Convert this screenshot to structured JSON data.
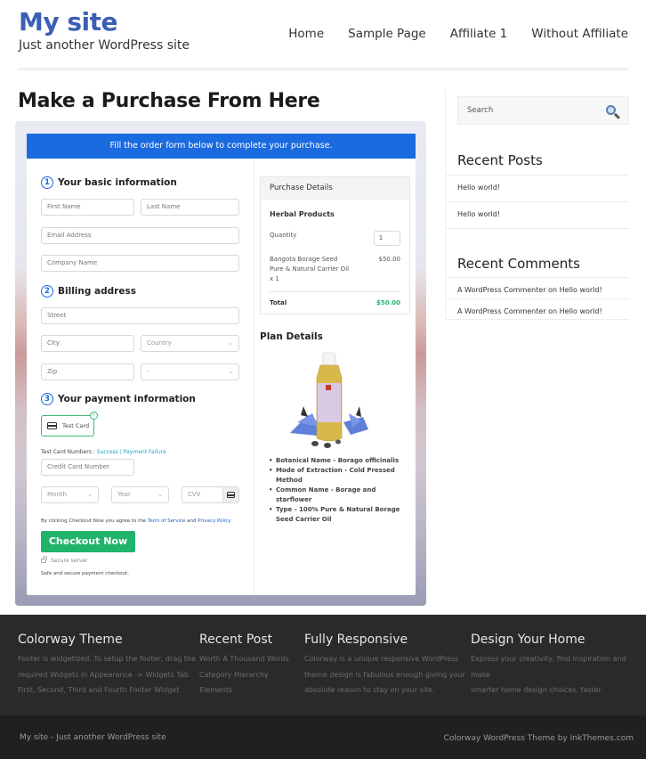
{
  "header": {
    "site_title": "My site",
    "tagline": "Just another WordPress site",
    "nav": [
      "Home",
      "Sample Page",
      "Affiliate 1",
      "Without Affiliate"
    ]
  },
  "page": {
    "title": "Make a Purchase From Here"
  },
  "checkout": {
    "banner": "Fill the order form below to complete your purchase.",
    "step1": {
      "num": "1",
      "label": "Your basic information"
    },
    "step2": {
      "num": "2",
      "label": "Billing address"
    },
    "step3": {
      "num": "3",
      "label": "Your payment information"
    },
    "placeholders": {
      "first_name": "First Name",
      "last_name": "Last Name",
      "email": "Email Address",
      "company": "Company Name",
      "street": "Street",
      "city": "City",
      "country": "Country",
      "zip": "Zip",
      "state": "-",
      "card_number": "Credit Card Number",
      "month": "Month",
      "year": "Year",
      "cvv": "CVV"
    },
    "payment_method": "Test Card",
    "test_numbers_label": "Test Card Numbers :",
    "test_success": "Success",
    "test_separator": "|",
    "test_failure": "Payment Failure",
    "terms_prefix": "By clicking Checkout Now you agree to the",
    "terms_link": "Term of Service",
    "terms_and": "and",
    "privacy_link": "Privacy Policy",
    "checkout_button": "Checkout Now",
    "secure_server": "Secure server",
    "safe_text": "Safe and secure payment checkout."
  },
  "purchase": {
    "heading": "Purchase Details",
    "product_group": "Herbal Products",
    "quantity_label": "Quantity",
    "quantity_value": "1",
    "item_line1": "Bangota Borage Seed",
    "item_line2": "Pure & Natural Carrier Oil",
    "item_line3": "x 1",
    "item_price": "$50.00",
    "total_label": "Total",
    "total_value": "$50.00",
    "total_color": "#22b36a"
  },
  "plan": {
    "title": "Plan Details",
    "features": [
      "Botanical Name - Borago officinalis",
      "Mode of Extraction - Cold Pressed Method",
      "Common Name - Borage and starflower",
      "Type - 100% Pure & Natural Borage Seed Carrier Oil"
    ]
  },
  "sidebar": {
    "search_placeholder": "Search",
    "recent_posts_title": "Recent Posts",
    "recent_posts": [
      "Hello world!",
      "Hello world!"
    ],
    "recent_comments_title": "Recent Comments",
    "recent_comments": [
      "A WordPress Commenter on Hello world!",
      "A WordPress Commenter on Hello world!"
    ]
  },
  "footer": {
    "columns": [
      {
        "title": "Colorway Theme",
        "lines": [
          "Footer is widgetized. To setup the footer, drag the",
          "required Widgets in Appearance -> Widgets Tab",
          "First, Second, Third and Fourth Footer Widget"
        ]
      },
      {
        "title": "Recent Post",
        "lines": [
          "Worth A Thousand Words",
          "Category Hierarchy",
          "Elements"
        ]
      },
      {
        "title": "Fully Responsive",
        "lines": [
          "Colorway is a unique responsive WordPress",
          "theme design is fabulous enough giving your",
          "absolute reason to stay on your site."
        ]
      },
      {
        "title": "Design Your Home",
        "lines": [
          "Express your creativity, find inspiration and make",
          "smarter home design choices, faster."
        ]
      }
    ],
    "bottom_left": "My site - Just another WordPress site",
    "bottom_right": "Colorway WordPress Theme by InkThemes.com"
  },
  "colors": {
    "brand_blue": "#3b5fb5",
    "banner_blue": "#1a6ae0",
    "checkout_green": "#22b36a",
    "footer_bg": "#2a2a2a"
  }
}
